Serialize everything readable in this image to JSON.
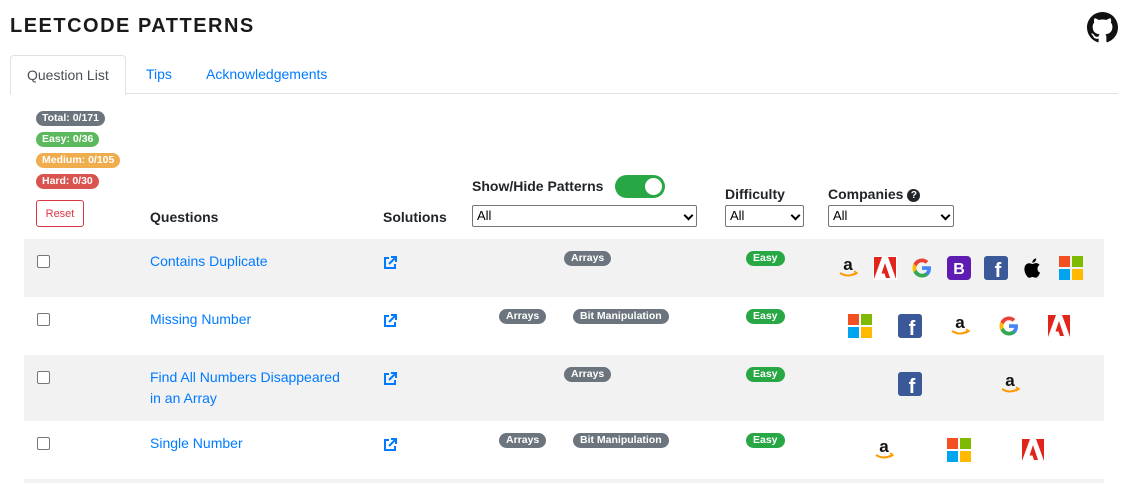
{
  "header": {
    "title": "LEETCODE PATTERNS",
    "github_icon": "github-icon"
  },
  "tabs": [
    {
      "label": "Question List",
      "active": true
    },
    {
      "label": "Tips",
      "active": false
    },
    {
      "label": "Acknowledgements",
      "active": false
    }
  ],
  "stats": {
    "total": "Total: 0/171",
    "easy": "Easy: 0/36",
    "medium": "Medium: 0/105",
    "hard": "Hard: 0/30",
    "reset_label": "Reset"
  },
  "columns": {
    "questions": "Questions",
    "solutions": "Solutions",
    "patterns": "Show/Hide Patterns",
    "difficulty": "Difficulty",
    "companies": "Companies"
  },
  "filters": {
    "patterns_value": "All",
    "difficulty_value": "All",
    "companies_value": "All",
    "patterns_visible": true
  },
  "colors": {
    "link": "#007bff",
    "pattern_badge": "#6c757d",
    "easy": "#28a745",
    "medium": "#f0ad4e",
    "hard": "#d9534f",
    "total": "#6c757d",
    "reset": "#dc3545"
  },
  "rows": [
    {
      "checked": false,
      "name_lines": [
        "Contains Duplicate"
      ],
      "patterns": [
        "Arrays"
      ],
      "difficulty": "Easy",
      "companies": [
        "amazon",
        "adobe",
        "google",
        "bloomberg",
        "facebook",
        "apple",
        "microsoft"
      ]
    },
    {
      "checked": false,
      "name_lines": [
        "Missing Number"
      ],
      "patterns": [
        "Arrays",
        "Bit Manipulation"
      ],
      "difficulty": "Easy",
      "companies": [
        "microsoft",
        "facebook",
        "amazon",
        "google",
        "adobe"
      ]
    },
    {
      "checked": false,
      "name_lines": [
        "Find All Numbers Disappeared",
        "in an Array"
      ],
      "patterns": [
        "Arrays"
      ],
      "difficulty": "Easy",
      "companies": [
        "facebook",
        "amazon"
      ]
    },
    {
      "checked": false,
      "name_lines": [
        "Single Number"
      ],
      "patterns": [
        "Arrays",
        "Bit Manipulation"
      ],
      "difficulty": "Easy",
      "companies": [
        "amazon",
        "microsoft",
        "adobe"
      ]
    }
  ]
}
